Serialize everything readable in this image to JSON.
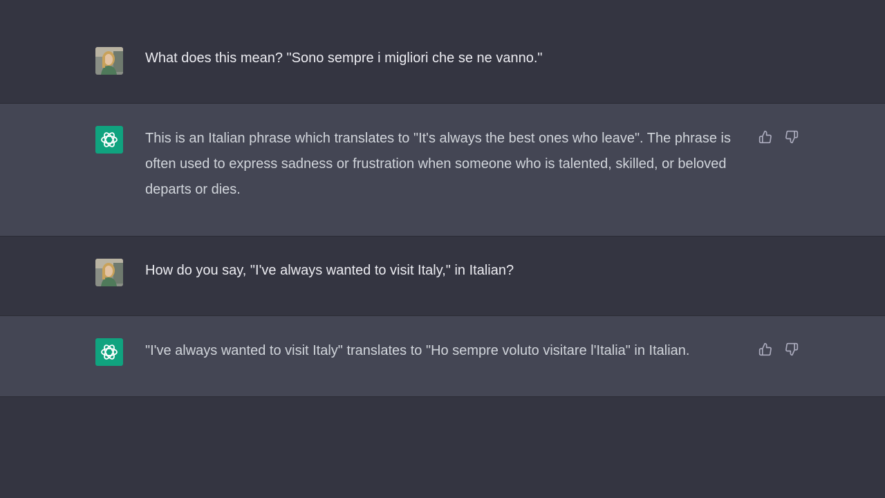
{
  "colors": {
    "background": "#343541",
    "assistant_background": "#444654",
    "bot_avatar": "#10a37f",
    "user_text": "#ececf1",
    "assistant_text": "#d1d5db",
    "icon": "#acacbe"
  },
  "messages": [
    {
      "role": "user",
      "avatar_icon": "user-photo-avatar",
      "text": "What does this mean? \"Sono sempre i migliori che se ne vanno.\""
    },
    {
      "role": "assistant",
      "avatar_icon": "openai-logo-icon",
      "text": "This is an Italian phrase which translates to \"It's always the best ones who leave\". The phrase is often used to express sadness or frustration when someone who is talented, skilled, or beloved departs or dies.",
      "feedback_icons": [
        "thumbs-up-icon",
        "thumbs-down-icon"
      ]
    },
    {
      "role": "user",
      "avatar_icon": "user-photo-avatar",
      "text": "How do you say, \"I've always wanted to visit Italy,\" in Italian?"
    },
    {
      "role": "assistant",
      "avatar_icon": "openai-logo-icon",
      "text": "\"I've always wanted to visit Italy\" translates to \"Ho sempre voluto visitare l'Italia\" in Italian.",
      "feedback_icons": [
        "thumbs-up-icon",
        "thumbs-down-icon"
      ]
    }
  ]
}
